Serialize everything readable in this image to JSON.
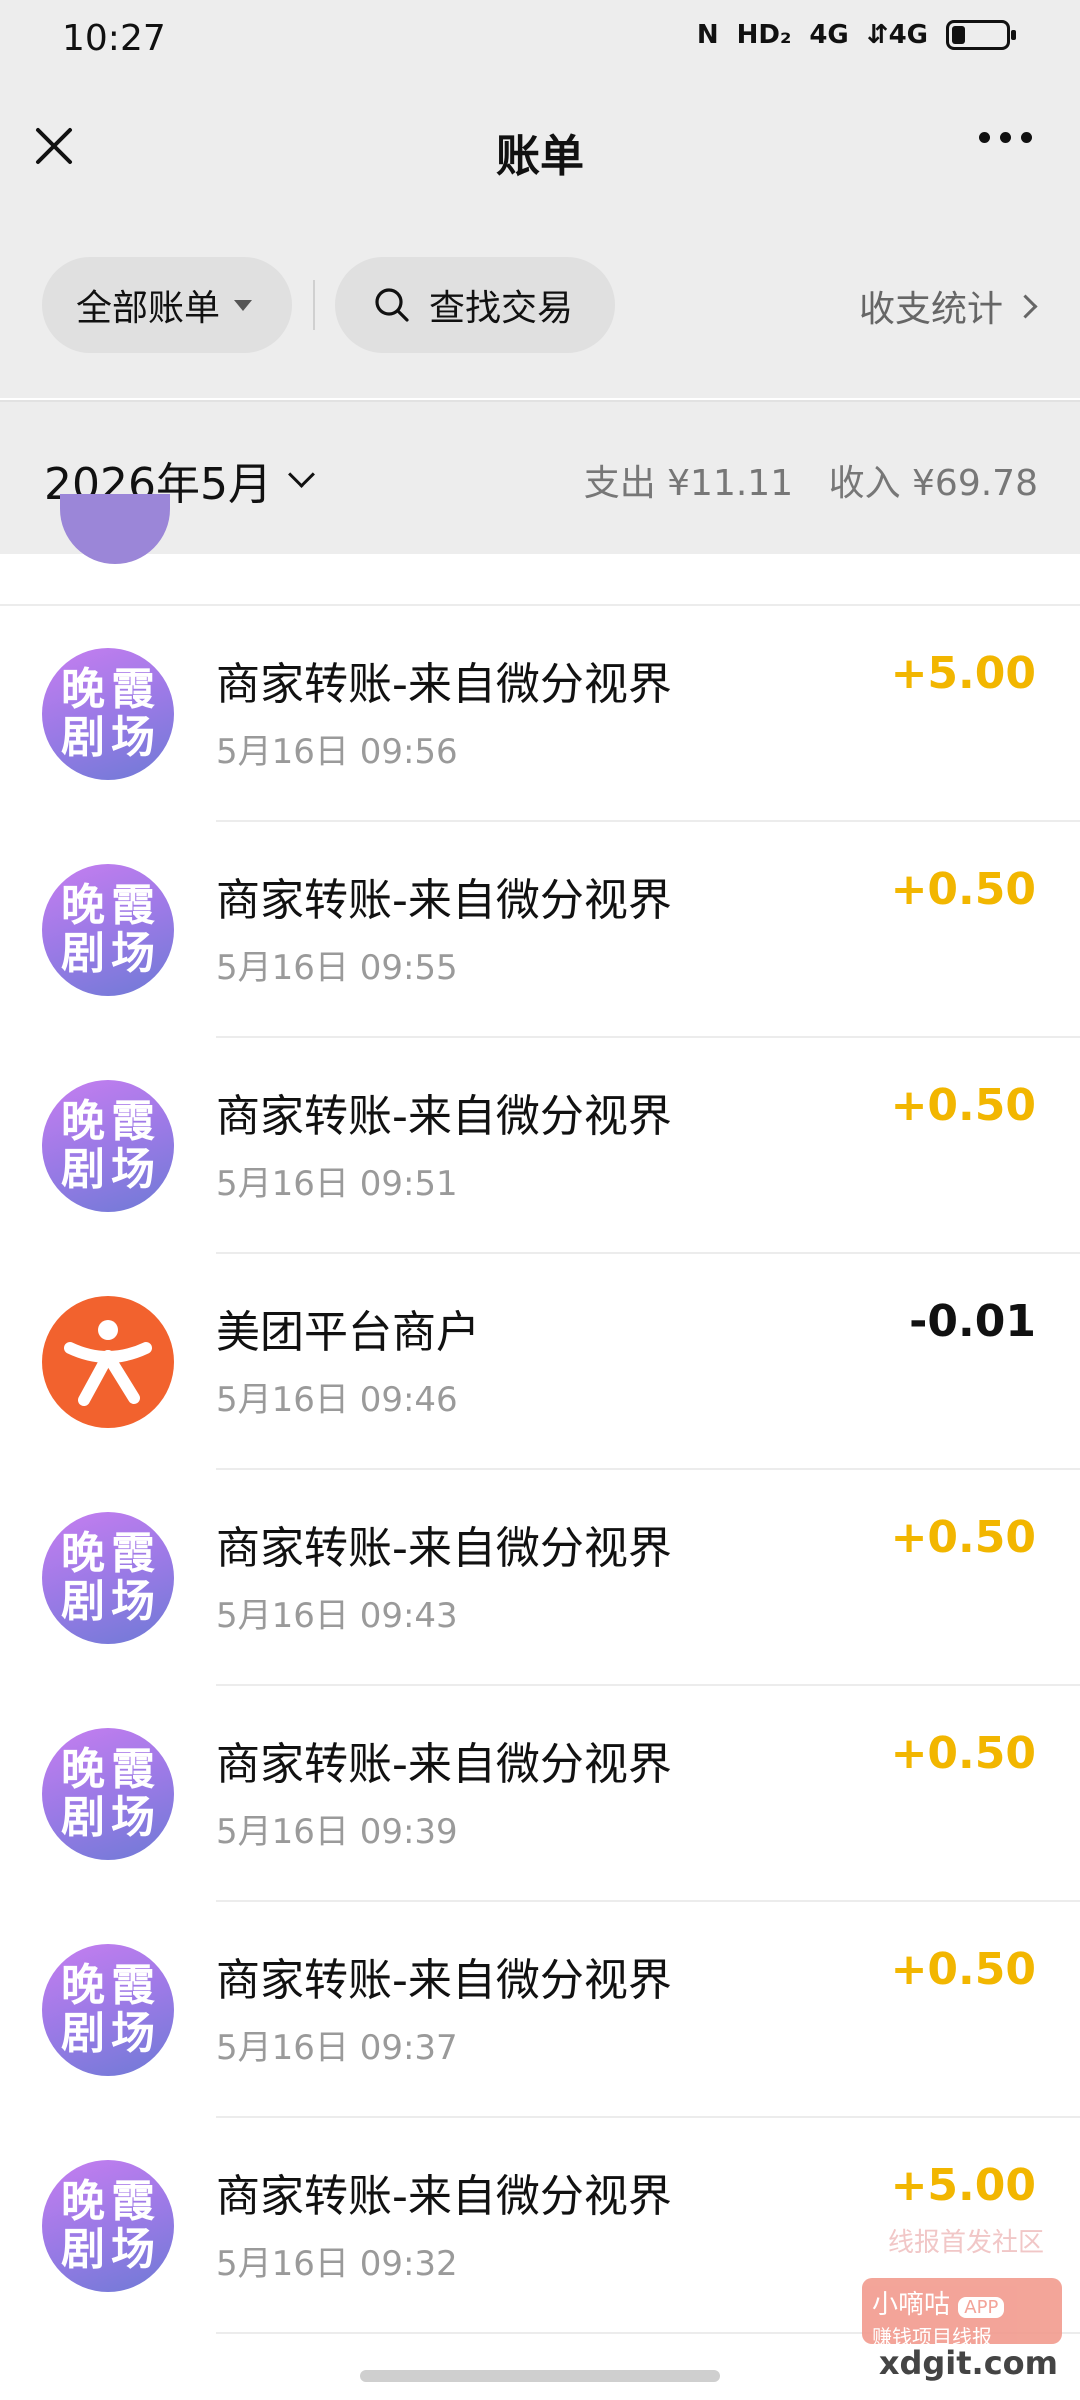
{
  "status_bar": {
    "time": "10:27",
    "icons": [
      "nfc-icon",
      "hd-icon",
      "signal-4g-icon",
      "signal-4g-icon",
      "battery-icon"
    ],
    "nfc": "N",
    "hd": "HD₂",
    "net1": "4G",
    "net2": "⇵4G",
    "battery_level": 0.25
  },
  "header": {
    "title": "账单"
  },
  "filters": {
    "all_label": "全部账单",
    "search_label": "查找交易",
    "stats_label": "收支统计"
  },
  "month": {
    "label": "2026年5月",
    "expense": "支出 ¥11.11",
    "income": "收入 ¥69.78"
  },
  "avatars": {
    "xia": [
      "晚",
      "霞",
      "剧",
      "场"
    ]
  },
  "transactions": [
    {
      "title": "商家转账-来自微分视界",
      "time": "5月16日 09:56",
      "amount": "+5.00",
      "type": "in",
      "avatar": "xia"
    },
    {
      "title": "商家转账-来自微分视界",
      "time": "5月16日 09:55",
      "amount": "+0.50",
      "type": "in",
      "avatar": "xia"
    },
    {
      "title": "商家转账-来自微分视界",
      "time": "5月16日 09:51",
      "amount": "+0.50",
      "type": "in",
      "avatar": "xia"
    },
    {
      "title": "美团平台商户",
      "time": "5月16日 09:46",
      "amount": "-0.01",
      "type": "out",
      "avatar": "meituan"
    },
    {
      "title": "商家转账-来自微分视界",
      "time": "5月16日 09:43",
      "amount": "+0.50",
      "type": "in",
      "avatar": "xia"
    },
    {
      "title": "商家转账-来自微分视界",
      "time": "5月16日 09:39",
      "amount": "+0.50",
      "type": "in",
      "avatar": "xia"
    },
    {
      "title": "商家转账-来自微分视界",
      "time": "5月16日 09:37",
      "amount": "+0.50",
      "type": "in",
      "avatar": "xia"
    },
    {
      "title": "商家转账-来自微分视界",
      "time": "5月16日 09:32",
      "amount": "+5.00",
      "type": "in",
      "avatar": "xia"
    }
  ],
  "watermark": {
    "text": "线报首发社区",
    "badge_title": "小嘀咕",
    "badge_tag": "APP",
    "badge_sub": "赚钱项目线报",
    "domain": "xdgit.com"
  },
  "colors": {
    "income": "#f2b600",
    "expense": "#111111",
    "header_bg": "#ededed",
    "meituan": "#f2622e"
  }
}
